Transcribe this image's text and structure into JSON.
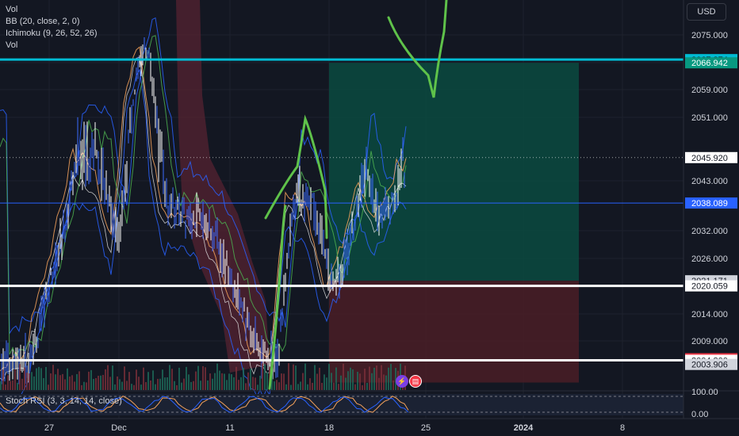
{
  "legend": {
    "items": [
      "Vol",
      "BB (20, close, 2, 0)",
      "Ichimoku (9, 26, 52, 26)",
      "Vol"
    ]
  },
  "currency": "USD",
  "stoch_label": "Stoch RSI (3, 3, 14, 14, close)",
  "colors": {
    "background": "#131722",
    "grid": "#1e222d",
    "text": "#d1d4dc",
    "cyan_line": "#00bcd4",
    "blue_line": "#2962ff",
    "profit_zone": "#0b4a40",
    "loss_zone": "#4a1d26",
    "green_drawing": "#5fc24a",
    "up_candle": "#ffffff",
    "down_candle": "#3b6bff"
  },
  "chart_data": {
    "type": "line",
    "symbol_currency": "USD",
    "x_ticks": [
      "27",
      "Dec",
      "11",
      "18",
      "25",
      "2024",
      "8"
    ],
    "y_ticks": [
      2075.0,
      2067.0,
      2059.0,
      2051.0,
      2043.0,
      2032.0,
      2026.0,
      2020.0,
      2014.0,
      2009.0
    ],
    "y_tick_labels": [
      "2075.000",
      "2067.000",
      "2059.000",
      "2051.000",
      "2043.000",
      "2032.000",
      "2026.000",
      "2020.000",
      "2014.000",
      "2009.000"
    ],
    "ylim": [
      2002,
      2080
    ],
    "price_labels": [
      {
        "name": "resistance",
        "value": "2067.874",
        "bg": "#00bcd4",
        "fg": "#131722"
      },
      {
        "name": "target",
        "value": "2066.942",
        "bg": "#089981",
        "fg": "#ffffff"
      },
      {
        "name": "last-price",
        "value": "2045.920",
        "bg": "#ffffff",
        "fg": "#131722"
      },
      {
        "name": "blue-level",
        "value": "2038.089",
        "bg": "#2962ff",
        "fg": "#ffffff"
      },
      {
        "name": "entry",
        "value": "2021.171",
        "bg": "#d1d4dc",
        "fg": "#131722"
      },
      {
        "name": "support",
        "value": "2020.059",
        "bg": "#ffffff",
        "fg": "#131722"
      },
      {
        "name": "stop",
        "value": "2005.136",
        "bg": "#f23645",
        "fg": "#ffffff"
      },
      {
        "name": "support-2",
        "value": "2004.800",
        "bg": "#ffffff",
        "fg": "#131722"
      },
      {
        "name": "bb-lower",
        "value": "2003.906",
        "bg": "#d1d4dc",
        "fg": "#131722"
      }
    ],
    "levels": [
      {
        "name": "resistance",
        "value": 2067.874,
        "color": "#00bcd4"
      },
      {
        "name": "blue-level",
        "value": 2038.089,
        "color": "#2962ff"
      },
      {
        "name": "support",
        "value": 2020.059,
        "color": "#ffffff"
      },
      {
        "name": "support-2",
        "value": 2004.8,
        "color": "#ffffff"
      }
    ],
    "position": {
      "entry": 2021.171,
      "target": 2066.942,
      "stop": 2005.136,
      "start_tick": "18",
      "end_tick": "2024"
    },
    "stoch_ticks": [
      "100.00",
      "0.00"
    ]
  }
}
